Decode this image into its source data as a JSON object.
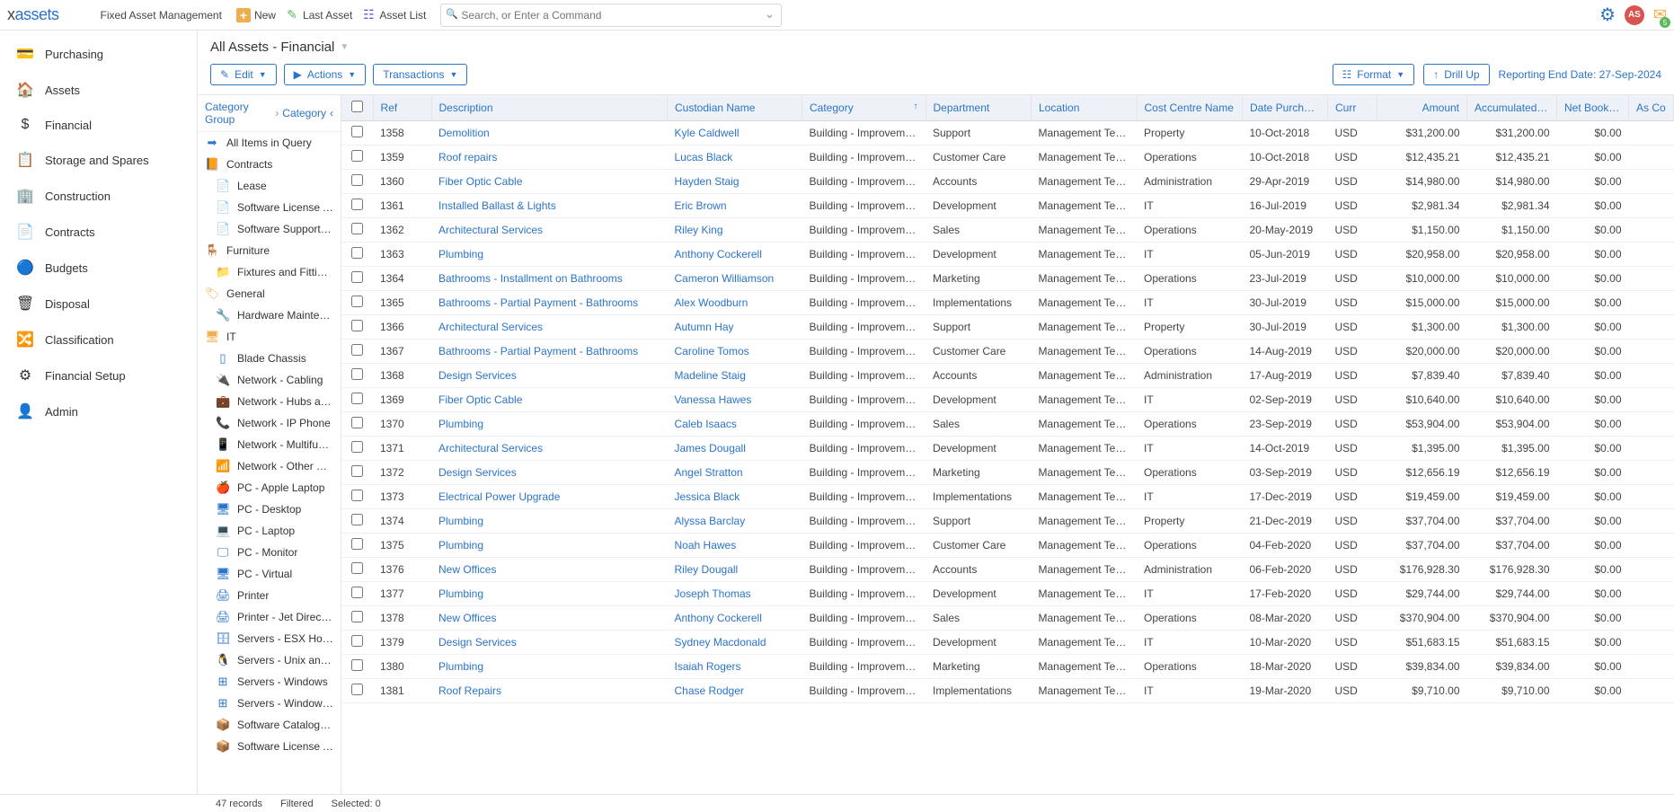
{
  "logo": {
    "prefix": "x",
    "suffix": "assets"
  },
  "appTitle": "Fixed Asset Management",
  "topActions": {
    "new": "New",
    "last": "Last Asset",
    "list": "Asset List"
  },
  "search": {
    "placeholder": "Search, or Enter a Command"
  },
  "user": {
    "initials": "AS",
    "mailCount": "5"
  },
  "leftNav": [
    {
      "icon": "💳",
      "label": "Purchasing"
    },
    {
      "icon": "🏠",
      "label": "Assets"
    },
    {
      "icon": "$",
      "label": "Financial"
    },
    {
      "icon": "📋",
      "label": "Storage and Spares"
    },
    {
      "icon": "🏢",
      "label": "Construction"
    },
    {
      "icon": "📄",
      "label": "Contracts",
      "green": true
    },
    {
      "icon": "🔵",
      "label": "Budgets"
    },
    {
      "icon": "🗑",
      "label": "Disposal"
    },
    {
      "icon": "🔀",
      "label": "Classification"
    },
    {
      "icon": "⚙",
      "label": "Financial Setup"
    },
    {
      "icon": "👤",
      "label": "Admin",
      "blue": true
    }
  ],
  "pageTitle": "All Assets - Financial",
  "toolbar": {
    "edit": "Edit",
    "actions": "Actions",
    "transactions": "Transactions",
    "format": "Format",
    "drillup": "Drill Up",
    "reportDate": "Reporting End Date: 27-Sep-2024"
  },
  "catCrumb": {
    "a": "Category Group",
    "b": "Category"
  },
  "catTree": [
    {
      "icon": "➡",
      "iconColor": "#2b74c7",
      "label": "All Items in Query"
    },
    {
      "icon": "📙",
      "iconColor": "#f0ad4e",
      "label": "Contracts"
    },
    {
      "icon": "📄",
      "iconColor": "#2b74c7",
      "label": "Lease",
      "indent": true
    },
    {
      "icon": "📄",
      "iconColor": "#2b74c7",
      "label": "Software License Agreement",
      "indent": true
    },
    {
      "icon": "📄",
      "iconColor": "#2b74c7",
      "label": "Software Support Contract",
      "indent": true
    },
    {
      "icon": "🪑",
      "iconColor": "#f0ad4e",
      "label": "Furniture"
    },
    {
      "icon": "📁",
      "iconColor": "#f0ad4e",
      "label": "Fixtures and Fittings",
      "indent": true
    },
    {
      "icon": "🏷",
      "iconColor": "#f0ad4e",
      "label": "General"
    },
    {
      "icon": "🔧",
      "iconColor": "#2b74c7",
      "label": "Hardware Maintenance Contract",
      "indent": true
    },
    {
      "icon": "🖥",
      "iconColor": "#f0ad4e",
      "label": "IT"
    },
    {
      "icon": "▯",
      "iconColor": "#2b74c7",
      "label": "Blade Chassis",
      "indent": true
    },
    {
      "icon": "🔌",
      "iconColor": "#2b74c7",
      "label": "Network - Cabling",
      "indent": true
    },
    {
      "icon": "💼",
      "iconColor": "#2b74c7",
      "label": "Network - Hubs and Conc",
      "indent": true
    },
    {
      "icon": "📞",
      "iconColor": "#2b74c7",
      "label": "Network - IP Phone",
      "indent": true
    },
    {
      "icon": "📱",
      "iconColor": "#2b74c7",
      "label": "Network - Multifunction D",
      "indent": true
    },
    {
      "icon": "📶",
      "iconColor": "#2b74c7",
      "label": "Network - Other Device",
      "indent": true
    },
    {
      "icon": "🍎",
      "iconColor": "#2b74c7",
      "label": "PC - Apple Laptop",
      "indent": true
    },
    {
      "icon": "🖥",
      "iconColor": "#2b74c7",
      "label": "PC - Desktop",
      "indent": true
    },
    {
      "icon": "💻",
      "iconColor": "#2b74c7",
      "label": "PC - Laptop",
      "indent": true
    },
    {
      "icon": "🖵",
      "iconColor": "#2b74c7",
      "label": "PC - Monitor",
      "indent": true
    },
    {
      "icon": "🖥",
      "iconColor": "#2b74c7",
      "label": "PC - Virtual",
      "indent": true
    },
    {
      "icon": "🖨",
      "iconColor": "#2b74c7",
      "label": "Printer",
      "indent": true
    },
    {
      "icon": "🖨",
      "iconColor": "#2b74c7",
      "label": "Printer - Jet Direct Card",
      "indent": true
    },
    {
      "icon": "🗄",
      "iconColor": "#2b74c7",
      "label": "Servers - ESX Hosts",
      "indent": true
    },
    {
      "icon": "🐧",
      "iconColor": "#2b74c7",
      "label": "Servers - Unix and Linux",
      "indent": true
    },
    {
      "icon": "⊞",
      "iconColor": "#2b74c7",
      "label": "Servers - Windows",
      "indent": true
    },
    {
      "icon": "⊞",
      "iconColor": "#2b74c7",
      "label": "Servers - Windows VM",
      "indent": true
    },
    {
      "icon": "📦",
      "iconColor": "#2b74c7",
      "label": "Software Catalog Entry",
      "indent": true
    },
    {
      "icon": "📦",
      "iconColor": "#2b74c7",
      "label": "Software License Asset",
      "indent": true
    }
  ],
  "columns": {
    "ref": "Ref",
    "desc": "Description",
    "cust": "Custodian Name",
    "cat": "Category",
    "dept": "Department",
    "loc": "Location",
    "cc": "Cost Centre Name",
    "date": "Date Purchased",
    "curr": "Curr",
    "amt": "Amount",
    "dep": "Accumulated Depreciation",
    "nbv": "Net Book Value",
    "extra": "As Co"
  },
  "rows": [
    {
      "ref": "1358",
      "desc": "Demolition",
      "cust": "Kyle Caldwell",
      "cat": "Building - Improvement",
      "dept": "Support",
      "loc": "Management Team S",
      "cc": "Property",
      "date": "10-Oct-2018",
      "curr": "USD",
      "amt": "$31,200.00",
      "dep": "$31,200.00",
      "nbv": "$0.00"
    },
    {
      "ref": "1359",
      "desc": "Roof repairs",
      "cust": "Lucas Black",
      "cat": "Building - Improvement",
      "dept": "Customer Care",
      "loc": "Management Team S",
      "cc": "Operations",
      "date": "10-Oct-2018",
      "curr": "USD",
      "amt": "$12,435.21",
      "dep": "$12,435.21",
      "nbv": "$0.00"
    },
    {
      "ref": "1360",
      "desc": "Fiber Optic Cable",
      "cust": "Hayden Staig",
      "cat": "Building - Improvement",
      "dept": "Accounts",
      "loc": "Management Team S",
      "cc": "Administration",
      "date": "29-Apr-2019",
      "curr": "USD",
      "amt": "$14,980.00",
      "dep": "$14,980.00",
      "nbv": "$0.00"
    },
    {
      "ref": "1361",
      "desc": "Installed Ballast & Lights",
      "cust": "Eric Brown",
      "cat": "Building - Improvement",
      "dept": "Development",
      "loc": "Management Team S",
      "cc": "IT",
      "date": "16-Jul-2019",
      "curr": "USD",
      "amt": "$2,981.34",
      "dep": "$2,981.34",
      "nbv": "$0.00"
    },
    {
      "ref": "1362",
      "desc": "Architectural Services",
      "cust": "Riley King",
      "cat": "Building - Improvement",
      "dept": "Sales",
      "loc": "Management Team S",
      "cc": "Operations",
      "date": "20-May-2019",
      "curr": "USD",
      "amt": "$1,150.00",
      "dep": "$1,150.00",
      "nbv": "$0.00"
    },
    {
      "ref": "1363",
      "desc": "Plumbing",
      "cust": "Anthony Cockerell",
      "cat": "Building - Improvement",
      "dept": "Development",
      "loc": "Management Team S",
      "cc": "IT",
      "date": "05-Jun-2019",
      "curr": "USD",
      "amt": "$20,958.00",
      "dep": "$20,958.00",
      "nbv": "$0.00"
    },
    {
      "ref": "1364",
      "desc": "Bathrooms - Installment on Bathrooms",
      "cust": "Cameron Williamson",
      "cat": "Building - Improvement",
      "dept": "Marketing",
      "loc": "Management Team S",
      "cc": "Operations",
      "date": "23-Jul-2019",
      "curr": "USD",
      "amt": "$10,000.00",
      "dep": "$10,000.00",
      "nbv": "$0.00"
    },
    {
      "ref": "1365",
      "desc": "Bathrooms - Partial Payment - Bathrooms",
      "cust": "Alex Woodburn",
      "cat": "Building - Improvement",
      "dept": "Implementations",
      "loc": "Management Team S",
      "cc": "IT",
      "date": "30-Jul-2019",
      "curr": "USD",
      "amt": "$15,000.00",
      "dep": "$15,000.00",
      "nbv": "$0.00"
    },
    {
      "ref": "1366",
      "desc": "Architectural Services",
      "cust": "Autumn Hay",
      "cat": "Building - Improvement",
      "dept": "Support",
      "loc": "Management Team S",
      "cc": "Property",
      "date": "30-Jul-2019",
      "curr": "USD",
      "amt": "$1,300.00",
      "dep": "$1,300.00",
      "nbv": "$0.00"
    },
    {
      "ref": "1367",
      "desc": "Bathrooms - Partial Payment - Bathrooms",
      "cust": "Caroline Tomos",
      "cat": "Building - Improvement",
      "dept": "Customer Care",
      "loc": "Management Team S",
      "cc": "Operations",
      "date": "14-Aug-2019",
      "curr": "USD",
      "amt": "$20,000.00",
      "dep": "$20,000.00",
      "nbv": "$0.00"
    },
    {
      "ref": "1368",
      "desc": "Design Services",
      "cust": "Madeline Staig",
      "cat": "Building - Improvement",
      "dept": "Accounts",
      "loc": "Management Team S",
      "cc": "Administration",
      "date": "17-Aug-2019",
      "curr": "USD",
      "amt": "$7,839.40",
      "dep": "$7,839.40",
      "nbv": "$0.00"
    },
    {
      "ref": "1369",
      "desc": "Fiber Optic Cable",
      "cust": "Vanessa Hawes",
      "cat": "Building - Improvement",
      "dept": "Development",
      "loc": "Management Team S",
      "cc": "IT",
      "date": "02-Sep-2019",
      "curr": "USD",
      "amt": "$10,640.00",
      "dep": "$10,640.00",
      "nbv": "$0.00"
    },
    {
      "ref": "1370",
      "desc": "Plumbing",
      "cust": "Caleb Isaacs",
      "cat": "Building - Improvement",
      "dept": "Sales",
      "loc": "Management Team S",
      "cc": "Operations",
      "date": "23-Sep-2019",
      "curr": "USD",
      "amt": "$53,904.00",
      "dep": "$53,904.00",
      "nbv": "$0.00"
    },
    {
      "ref": "1371",
      "desc": "Architectural Services",
      "cust": "James Dougall",
      "cat": "Building - Improvement",
      "dept": "Development",
      "loc": "Management Team S",
      "cc": "IT",
      "date": "14-Oct-2019",
      "curr": "USD",
      "amt": "$1,395.00",
      "dep": "$1,395.00",
      "nbv": "$0.00"
    },
    {
      "ref": "1372",
      "desc": "Design Services",
      "cust": "Angel Stratton",
      "cat": "Building - Improvement",
      "dept": "Marketing",
      "loc": "Management Team S",
      "cc": "Operations",
      "date": "03-Sep-2019",
      "curr": "USD",
      "amt": "$12,656.19",
      "dep": "$12,656.19",
      "nbv": "$0.00"
    },
    {
      "ref": "1373",
      "desc": "Electrical Power Upgrade",
      "cust": "Jessica Black",
      "cat": "Building - Improvement",
      "dept": "Implementations",
      "loc": "Management Team S",
      "cc": "IT",
      "date": "17-Dec-2019",
      "curr": "USD",
      "amt": "$19,459.00",
      "dep": "$19,459.00",
      "nbv": "$0.00"
    },
    {
      "ref": "1374",
      "desc": "Plumbing",
      "cust": "Alyssa Barclay",
      "cat": "Building - Improvement",
      "dept": "Support",
      "loc": "Management Team S",
      "cc": "Property",
      "date": "21-Dec-2019",
      "curr": "USD",
      "amt": "$37,704.00",
      "dep": "$37,704.00",
      "nbv": "$0.00"
    },
    {
      "ref": "1375",
      "desc": "Plumbing",
      "cust": "Noah Hawes",
      "cat": "Building - Improvement",
      "dept": "Customer Care",
      "loc": "Management Team S",
      "cc": "Operations",
      "date": "04-Feb-2020",
      "curr": "USD",
      "amt": "$37,704.00",
      "dep": "$37,704.00",
      "nbv": "$0.00"
    },
    {
      "ref": "1376",
      "desc": "New Offices",
      "cust": "Riley Dougall",
      "cat": "Building - Improvement",
      "dept": "Accounts",
      "loc": "Management Team S",
      "cc": "Administration",
      "date": "06-Feb-2020",
      "curr": "USD",
      "amt": "$176,928.30",
      "dep": "$176,928.30",
      "nbv": "$0.00"
    },
    {
      "ref": "1377",
      "desc": "Plumbing",
      "cust": "Joseph Thomas",
      "cat": "Building - Improvement",
      "dept": "Development",
      "loc": "Management Team S",
      "cc": "IT",
      "date": "17-Feb-2020",
      "curr": "USD",
      "amt": "$29,744.00",
      "dep": "$29,744.00",
      "nbv": "$0.00"
    },
    {
      "ref": "1378",
      "desc": "New Offices",
      "cust": "Anthony Cockerell",
      "cat": "Building - Improvement",
      "dept": "Sales",
      "loc": "Management Team S",
      "cc": "Operations",
      "date": "08-Mar-2020",
      "curr": "USD",
      "amt": "$370,904.00",
      "dep": "$370,904.00",
      "nbv": "$0.00"
    },
    {
      "ref": "1379",
      "desc": "Design Services",
      "cust": "Sydney Macdonald",
      "cat": "Building - Improvement",
      "dept": "Development",
      "loc": "Management Team S",
      "cc": "IT",
      "date": "10-Mar-2020",
      "curr": "USD",
      "amt": "$51,683.15",
      "dep": "$51,683.15",
      "nbv": "$0.00"
    },
    {
      "ref": "1380",
      "desc": "Plumbing",
      "cust": "Isaiah Rogers",
      "cat": "Building - Improvement",
      "dept": "Marketing",
      "loc": "Management Team S",
      "cc": "Operations",
      "date": "18-Mar-2020",
      "curr": "USD",
      "amt": "$39,834.00",
      "dep": "$39,834.00",
      "nbv": "$0.00"
    },
    {
      "ref": "1381",
      "desc": "Roof Repairs",
      "cust": "Chase Rodger",
      "cat": "Building - Improvement",
      "dept": "Implementations",
      "loc": "Management Team S",
      "cc": "IT",
      "date": "19-Mar-2020",
      "curr": "USD",
      "amt": "$9,710.00",
      "dep": "$9,710.00",
      "nbv": "$0.00"
    }
  ],
  "status": {
    "count": "47 records",
    "filtered": "Filtered",
    "selected": "Selected: 0"
  }
}
